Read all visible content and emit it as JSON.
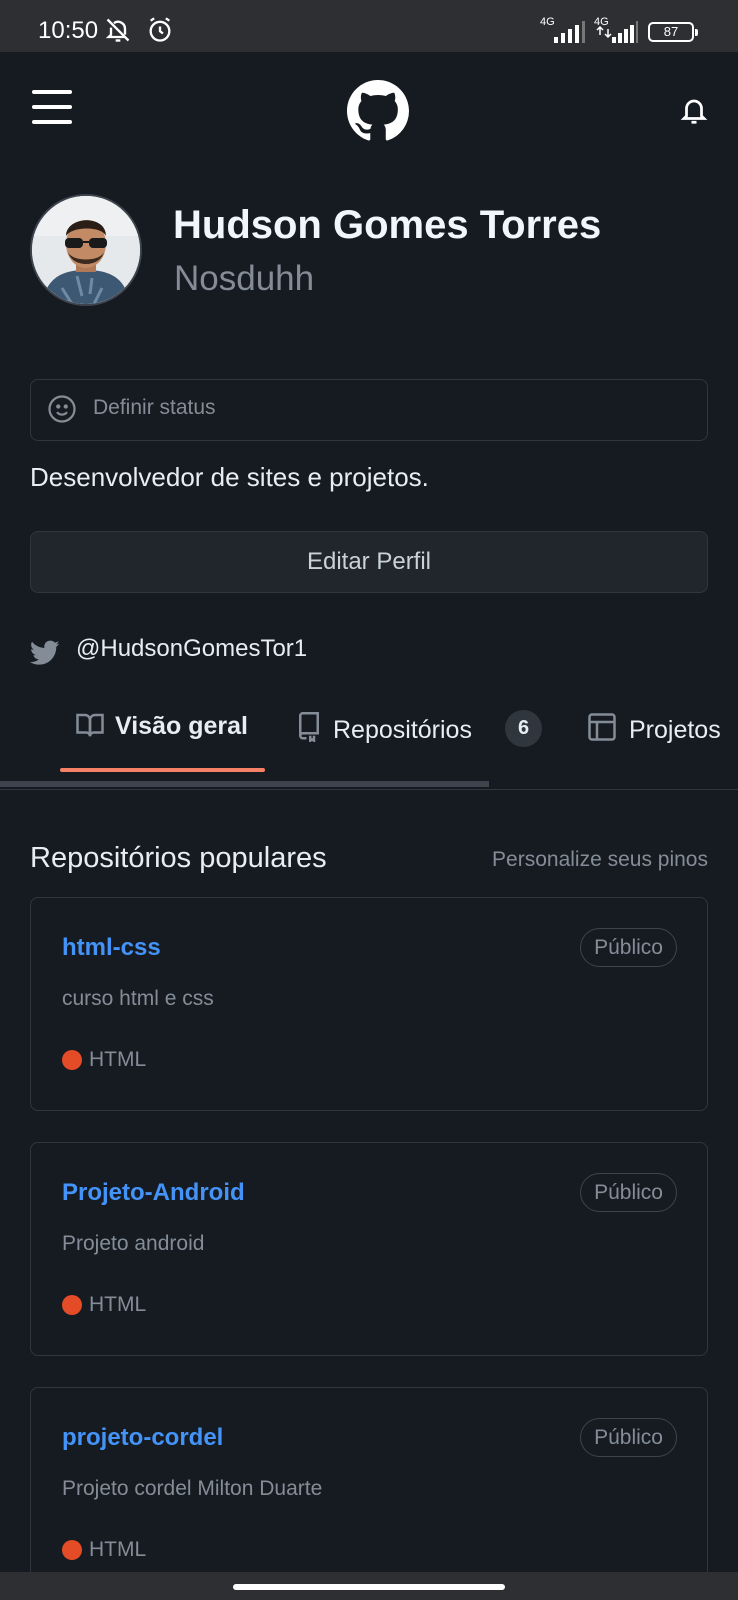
{
  "status_bar": {
    "time": "10:50",
    "signal_1": "4G",
    "signal_2": "4G",
    "battery": "87",
    "icons": [
      "bell-off-icon",
      "alarm-icon",
      "signal-icon",
      "battery-icon"
    ]
  },
  "top_bar": {
    "icons": [
      "menu-icon",
      "github-logo-icon",
      "notifications-icon"
    ]
  },
  "profile": {
    "full_name": "Hudson Gomes Torres",
    "login": "Nosduhh",
    "status_placeholder": "Definir status",
    "bio": "Desenvolvedor de sites e projetos.",
    "edit_button": "Editar Perfil",
    "twitter": "@HudsonGomesTor1"
  },
  "tabs": [
    {
      "label": "Visão geral",
      "icon": "book-icon",
      "active": true
    },
    {
      "label": "Repositórios",
      "icon": "repo-icon",
      "count": "6"
    },
    {
      "label": "Projetos",
      "icon": "table-icon"
    }
  ],
  "popular": {
    "title": "Repositórios populares",
    "customize_link": "Personalize seus pinos",
    "repos": [
      {
        "name": "html-css",
        "visibility": "Público",
        "description": "curso html e css",
        "language": "HTML",
        "language_color": "#e34c26"
      },
      {
        "name": "Projeto-Android",
        "visibility": "Público",
        "description": "Projeto android",
        "language": "HTML",
        "language_color": "#e34c26"
      },
      {
        "name": "projeto-cordel",
        "visibility": "Público",
        "description": "Projeto cordel Milton Duarte",
        "language": "HTML",
        "language_color": "#e34c26"
      }
    ]
  },
  "colors": {
    "background": "#161b22",
    "link": "#4493f8",
    "tab_underline": "#f78166",
    "muted": "#848d97"
  }
}
